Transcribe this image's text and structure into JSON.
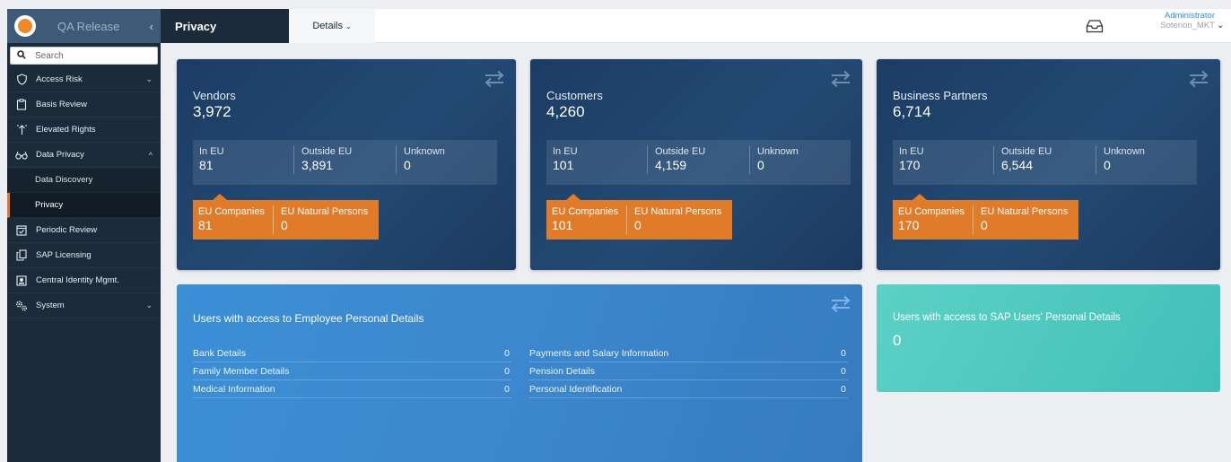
{
  "app": {
    "title": "QA Release",
    "collapse_glyph": "‹"
  },
  "search": {
    "placeholder": "Search"
  },
  "nav": {
    "access_risk": "Access Risk",
    "basis_review": "Basis Review",
    "elevated_rights": "Elevated Rights",
    "data_privacy": "Data Privacy",
    "data_discovery": "Data Discovery",
    "privacy": "Privacy",
    "periodic_review": "Periodic Review",
    "sap_licensing": "SAP Licensing",
    "central_identity": "Central Identity Mgmt.",
    "system": "System",
    "chevron_down": "⌄",
    "chevron_up": "^"
  },
  "header": {
    "active_tab": "Privacy",
    "details_tab": "Details",
    "details_chevron": "⌄",
    "user_name": "Administrator",
    "user_org": "Soterion_MKT",
    "user_chevron": "⌄"
  },
  "vendors": {
    "title": "Vendors",
    "total": "3,972",
    "in_eu_label": "In EU",
    "in_eu": "81",
    "outside_eu_label": "Outside EU",
    "outside_eu": "3,891",
    "unknown_label": "Unknown",
    "unknown": "0",
    "eu_companies_label": "EU Companies",
    "eu_companies": "81",
    "eu_persons_label": "EU Natural Persons",
    "eu_persons": "0"
  },
  "customers": {
    "title": "Customers",
    "total": "4,260",
    "in_eu_label": "In EU",
    "in_eu": "101",
    "outside_eu_label": "Outside EU",
    "outside_eu": "4,159",
    "unknown_label": "Unknown",
    "unknown": "0",
    "eu_companies_label": "EU Companies",
    "eu_companies": "101",
    "eu_persons_label": "EU Natural Persons",
    "eu_persons": "0"
  },
  "partners": {
    "title": "Business Partners",
    "total": "6,714",
    "in_eu_label": "In EU",
    "in_eu": "170",
    "outside_eu_label": "Outside EU",
    "outside_eu": "6,544",
    "unknown_label": "Unknown",
    "unknown": "0",
    "eu_companies_label": "EU Companies",
    "eu_companies": "170",
    "eu_persons_label": "EU Natural Persons",
    "eu_persons": "0"
  },
  "employee_access": {
    "title": "Users with access to Employee Personal Details",
    "left": [
      {
        "label": "Bank Details",
        "count": "0"
      },
      {
        "label": "Family Member Details",
        "count": "0"
      },
      {
        "label": "Medical Information",
        "count": "0"
      }
    ],
    "right": [
      {
        "label": "Payments and Salary Information",
        "count": "0"
      },
      {
        "label": "Pension Details",
        "count": "0"
      },
      {
        "label": "Personal Identification",
        "count": "0"
      }
    ]
  },
  "sap_users": {
    "title": "Users with access to SAP Users' Personal Details",
    "value": "0"
  },
  "colors": {
    "sidebar": "#1c2b3a",
    "brand_bar": "#3e5a78",
    "accent_orange": "#e07b2a",
    "card_dark": "#1c3c64",
    "card_blue": "#3b8fd6",
    "card_teal": "#41c0b8",
    "link_blue": "#2f8fd8"
  },
  "icons": [
    "search-icon",
    "shield-icon",
    "clipboard-icon",
    "elevated-rights-icon",
    "glasses-icon",
    "calendar-check-icon",
    "copy-icon",
    "id-card-icon",
    "gears-icon",
    "inbox-icon",
    "swap-arrows-icon"
  ]
}
